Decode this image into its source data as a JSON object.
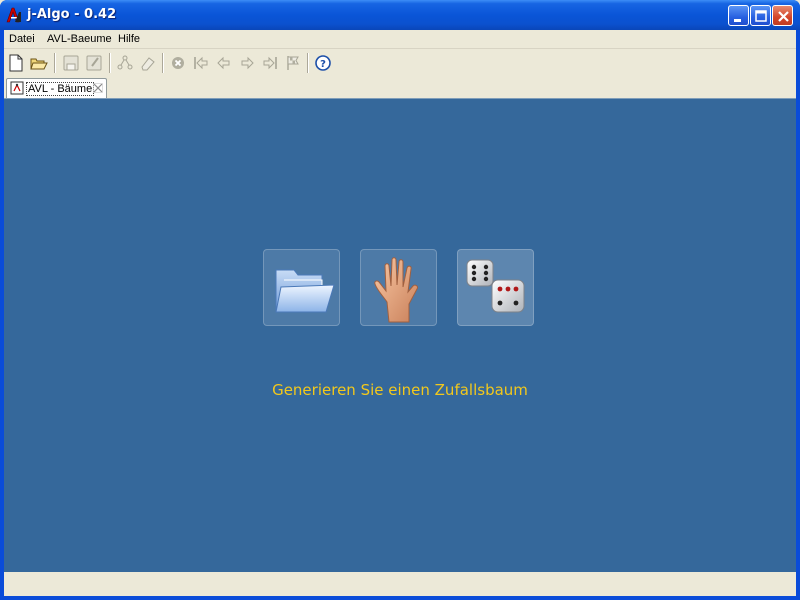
{
  "window": {
    "title": "j-Algo - 0.42"
  },
  "menu": {
    "items": [
      {
        "label": "Datei"
      },
      {
        "label": "AVL-Baeume"
      },
      {
        "label": "Hilfe"
      }
    ]
  },
  "toolbar": {
    "icons": [
      "new-file-icon",
      "open-folder-icon",
      "save-icon",
      "save-as-icon",
      "tree-icon",
      "eraser-icon",
      "abort-icon",
      "first-step-icon",
      "previous-step-icon",
      "next-step-icon",
      "last-step-icon",
      "finish-flag-icon",
      "help-icon"
    ]
  },
  "tab": {
    "label": "AVL - Bäume"
  },
  "main": {
    "buttons": [
      {
        "name": "open-folder-icon"
      },
      {
        "name": "hand-icon"
      },
      {
        "name": "dice-icon"
      }
    ],
    "hint": "Generieren Sie einen Zufallsbaum"
  },
  "colors": {
    "background": "#35689b",
    "hint_text": "#f2c81c",
    "titlebar": "#0a55d8"
  }
}
